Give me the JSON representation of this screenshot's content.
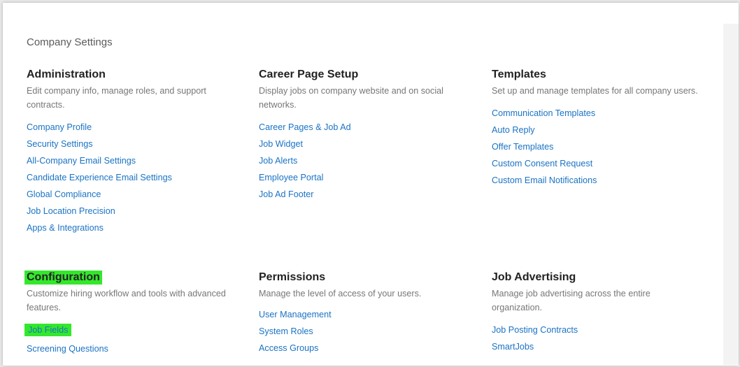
{
  "page": {
    "title": "Company Settings"
  },
  "sections": [
    {
      "title": "Administration",
      "description": "Edit company info, manage roles, and support contracts.",
      "links": [
        "Company Profile",
        "Security Settings",
        "All-Company Email Settings",
        "Candidate Experience Email Settings",
        "Global Compliance",
        "Job Location Precision",
        "Apps & Integrations"
      ]
    },
    {
      "title": "Career Page Setup",
      "description": "Display jobs on company website and on social networks.",
      "links": [
        "Career Pages & Job Ad",
        "Job Widget",
        "Job Alerts",
        "Employee Portal",
        "Job Ad Footer"
      ]
    },
    {
      "title": "Templates",
      "description": "Set up and manage templates for all company users.",
      "links": [
        "Communication Templates",
        "Auto Reply",
        "Offer Templates",
        "Custom Consent Request",
        "Custom Email Notifications"
      ]
    },
    {
      "title": "Configuration",
      "description": "Customize hiring workflow and tools with advanced features.",
      "links": [
        "Job Fields",
        "Screening Questions"
      ]
    },
    {
      "title": "Permissions",
      "description": "Manage the level of access of your users.",
      "links": [
        "User Management",
        "System Roles",
        "Access Groups"
      ]
    },
    {
      "title": "Job Advertising",
      "description": "Manage job advertising across the entire organization.",
      "links": [
        "Job Posting Contracts",
        "SmartJobs"
      ]
    }
  ],
  "colors": {
    "link": "#1a73c4",
    "highlight": "#33e82b"
  }
}
